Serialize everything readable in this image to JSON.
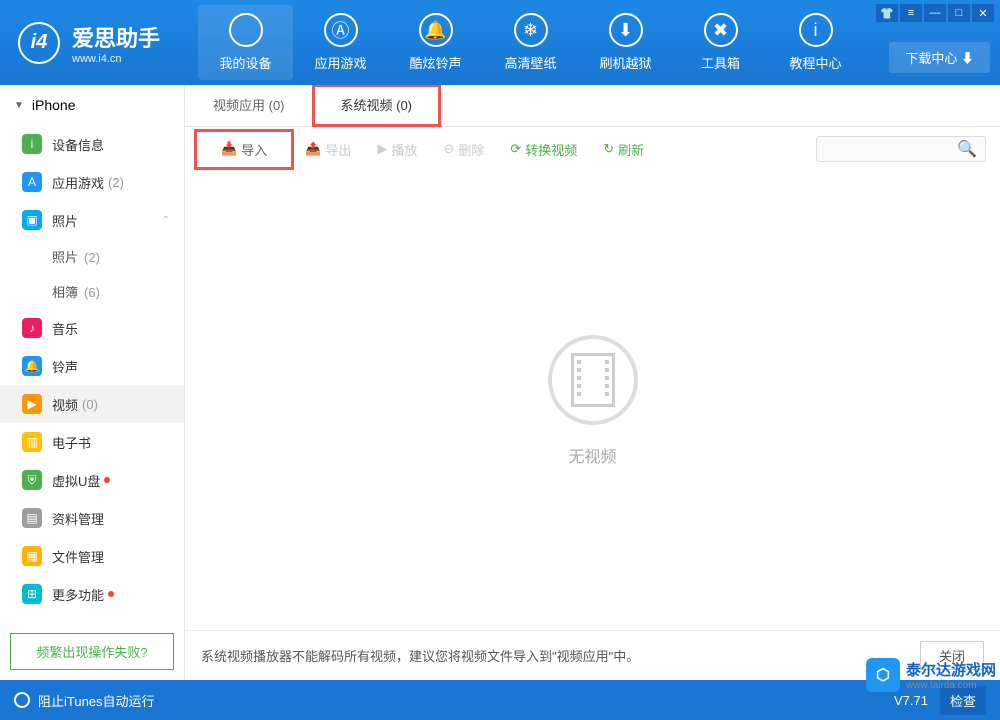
{
  "app": {
    "title": "爱思助手",
    "subtitle": "www.i4.cn"
  },
  "topnav": [
    {
      "label": "我的设备",
      "icon": ""
    },
    {
      "label": "应用游戏",
      "icon": "Ⓐ"
    },
    {
      "label": "酷炫铃声",
      "icon": "🔔"
    },
    {
      "label": "高清壁纸",
      "icon": "❄"
    },
    {
      "label": "刷机越狱",
      "icon": "⬇"
    },
    {
      "label": "工具箱",
      "icon": "✖"
    },
    {
      "label": "教程中心",
      "icon": "i"
    }
  ],
  "download_center": "下载中心 ⬇",
  "device_header": "iPhone",
  "sidebar": [
    {
      "label": "设备信息",
      "color": "#4caf50",
      "icon": "i"
    },
    {
      "label": "应用游戏",
      "count": "(2)",
      "color": "#2196f3",
      "icon": "A"
    },
    {
      "label": "照片",
      "color": "#03a9f4",
      "icon": "▣",
      "expandable": true
    },
    {
      "label": "音乐",
      "color": "#e91e63",
      "icon": "♪"
    },
    {
      "label": "铃声",
      "color": "#2196f3",
      "icon": "🔔"
    },
    {
      "label": "视频",
      "count": "(0)",
      "color": "#ff9800",
      "icon": "▶",
      "selected": true
    },
    {
      "label": "电子书",
      "color": "#ffc107",
      "icon": "▥"
    },
    {
      "label": "虚拟U盘",
      "color": "#4caf50",
      "icon": "⛨",
      "dot": true
    },
    {
      "label": "资料管理",
      "color": "#9e9e9e",
      "icon": "▤"
    },
    {
      "label": "文件管理",
      "color": "#ffb300",
      "icon": "▦"
    },
    {
      "label": "更多功能",
      "color": "#00bcd4",
      "icon": "⊞",
      "dot": true
    }
  ],
  "sidebar_photo_children": [
    {
      "label": "照片",
      "count": "(2)"
    },
    {
      "label": "相簿",
      "count": "(6)"
    }
  ],
  "help_link": "频繁出现操作失败?",
  "tabs": [
    {
      "label": "视频应用 (0)"
    },
    {
      "label": "系统视频 (0)",
      "active": true,
      "highlighted": true
    }
  ],
  "toolbar": {
    "import": "导入",
    "export": "导出",
    "play": "播放",
    "delete": "删除",
    "convert": "转换视频",
    "refresh": "刷新"
  },
  "empty_text": "无视频",
  "hint": {
    "text": "系统视频播放器不能解码所有视频，建议您将视频文件导入到\"视频应用\"中。",
    "close": "关闭"
  },
  "footer": {
    "itunes": "阻止iTunes自动运行",
    "version": "V7.71",
    "check": "检查"
  },
  "watermark": {
    "title": "泰尔达游戏网",
    "sub": "www.tairda.com"
  }
}
